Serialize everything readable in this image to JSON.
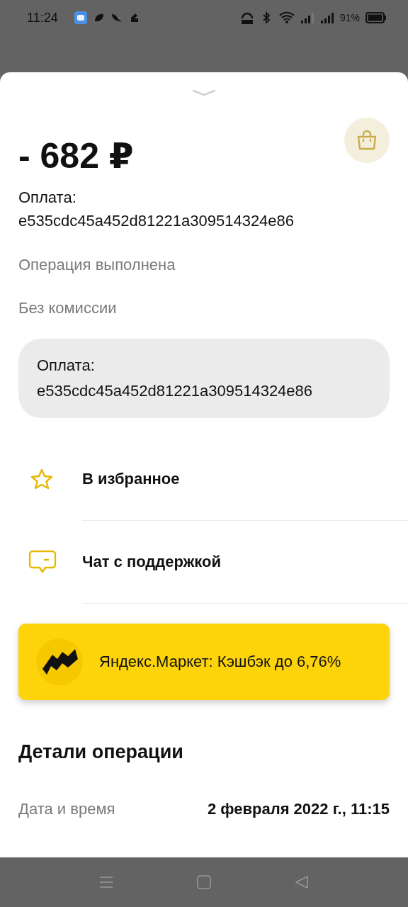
{
  "status_bar": {
    "time": "11:24",
    "battery": "91%"
  },
  "amount": "- 682 ₽",
  "title_label": "Оплата:",
  "title_value": "e535cdc45a452d81221a309514324e86",
  "status_lines": [
    "Операция выполнена",
    "Без комиссии"
  ],
  "comment": {
    "label": "Оплата:",
    "value": "e535cdc45a452d81221a309514324e86"
  },
  "actions": [
    {
      "kind": "star",
      "label": "В избранное"
    },
    {
      "kind": "chat",
      "label": "Чат с поддержкой"
    }
  ],
  "promo": {
    "text": "Яндекс.Маркет: Кэшбэк до 6,76%"
  },
  "details": {
    "title": "Детали операции",
    "rows": [
      {
        "label": "Дата и время",
        "value": "2 февраля 2022 г., 11:15"
      }
    ]
  }
}
